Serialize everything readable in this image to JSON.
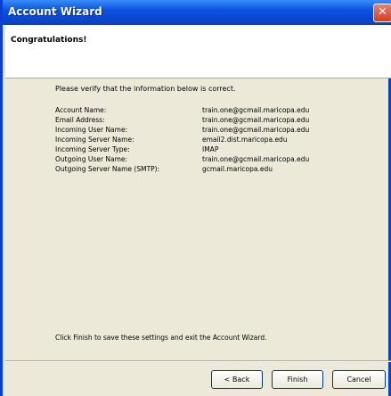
{
  "window": {
    "title": "Account Wizard",
    "close_glyph": "✕"
  },
  "header": {
    "title": "Congratulations!"
  },
  "content": {
    "intro": "Please verify that the information below is correct.",
    "rows": [
      {
        "label": "Account Name:",
        "value": "train.one@gcmail.maricopa.edu"
      },
      {
        "label": "Email Address:",
        "value": "train.one@gcmail.maricopa.edu"
      },
      {
        "label": "Incoming User Name:",
        "value": "train.one@gcmail.maricopa.edu"
      },
      {
        "label": "Incoming Server Name:",
        "value": "email2.dist.maricopa.edu"
      },
      {
        "label": "Incoming Server Type:",
        "value": "IMAP"
      },
      {
        "label": "Outgoing User Name:",
        "value": "train.one@gcmail.maricopa.edu"
      },
      {
        "label": "Outgoing Server Name (SMTP):",
        "value": "gcmail.maricopa.edu"
      }
    ],
    "footer": "Click Finish to save these settings and exit the Account Wizard."
  },
  "buttons": {
    "back": "< Back",
    "finish": "Finish",
    "cancel": "Cancel"
  }
}
